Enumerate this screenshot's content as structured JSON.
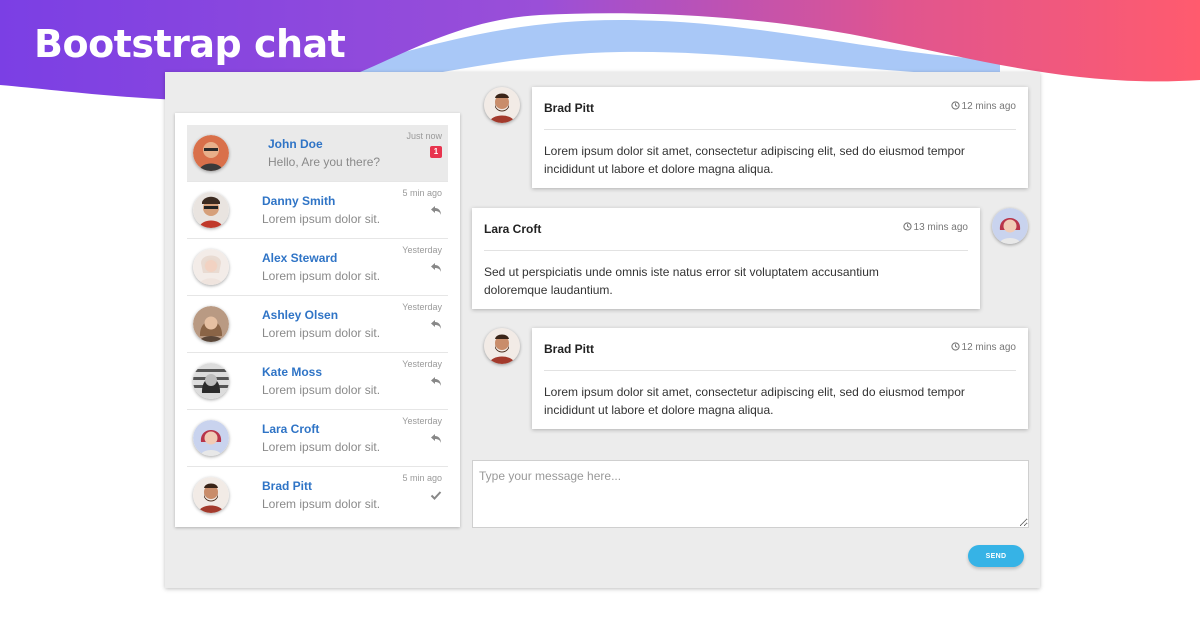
{
  "header": {
    "title": "Bootstrap chat"
  },
  "colors": {
    "wave_start": "#7b3fe4",
    "wave_end": "#ff5b6e",
    "wave_light": "#a9c8f7",
    "link_blue": "#2f74c6",
    "badge_red": "#e8344e",
    "send_blue": "#36b3e6"
  },
  "contacts": [
    {
      "name": "John Doe",
      "message": "Hello, Are you there?",
      "time": "Just now",
      "badge": "1",
      "status_icon": ""
    },
    {
      "name": "Danny Smith",
      "message": "Lorem ipsum dolor sit.",
      "time": "5 min ago",
      "badge": "",
      "status_icon": "reply-icon"
    },
    {
      "name": "Alex Steward",
      "message": "Lorem ipsum dolor sit.",
      "time": "Yesterday",
      "badge": "",
      "status_icon": "reply-icon"
    },
    {
      "name": "Ashley Olsen",
      "message": "Lorem ipsum dolor sit.",
      "time": "Yesterday",
      "badge": "",
      "status_icon": "reply-icon"
    },
    {
      "name": "Kate Moss",
      "message": "Lorem ipsum dolor sit.",
      "time": "Yesterday",
      "badge": "",
      "status_icon": "reply-icon"
    },
    {
      "name": "Lara Croft",
      "message": "Lorem ipsum dolor sit.",
      "time": "Yesterday",
      "badge": "",
      "status_icon": "reply-icon"
    },
    {
      "name": "Brad Pitt",
      "message": "Lorem ipsum dolor sit.",
      "time": "5 min ago",
      "badge": "",
      "status_icon": "check-icon"
    }
  ],
  "messages": [
    {
      "author": "Brad Pitt",
      "time": "12 mins ago",
      "body": "Lorem ipsum dolor sit amet, consectetur adipiscing elit, sed do eiusmod tempor incididunt ut labore et dolore magna aliqua."
    },
    {
      "author": "Lara Croft",
      "time": "13 mins ago",
      "body": "Sed ut perspiciatis unde omnis iste natus error sit voluptatem accusantium doloremque laudantium."
    },
    {
      "author": "Brad Pitt",
      "time": "12 mins ago",
      "body": "Lorem ipsum dolor sit amet, consectetur adipiscing elit, sed do eiusmod tempor incididunt ut labore et dolore magna aliqua."
    }
  ],
  "composer": {
    "placeholder": "Type your message here...",
    "value": ""
  },
  "send_button": {
    "label": "SEND"
  }
}
